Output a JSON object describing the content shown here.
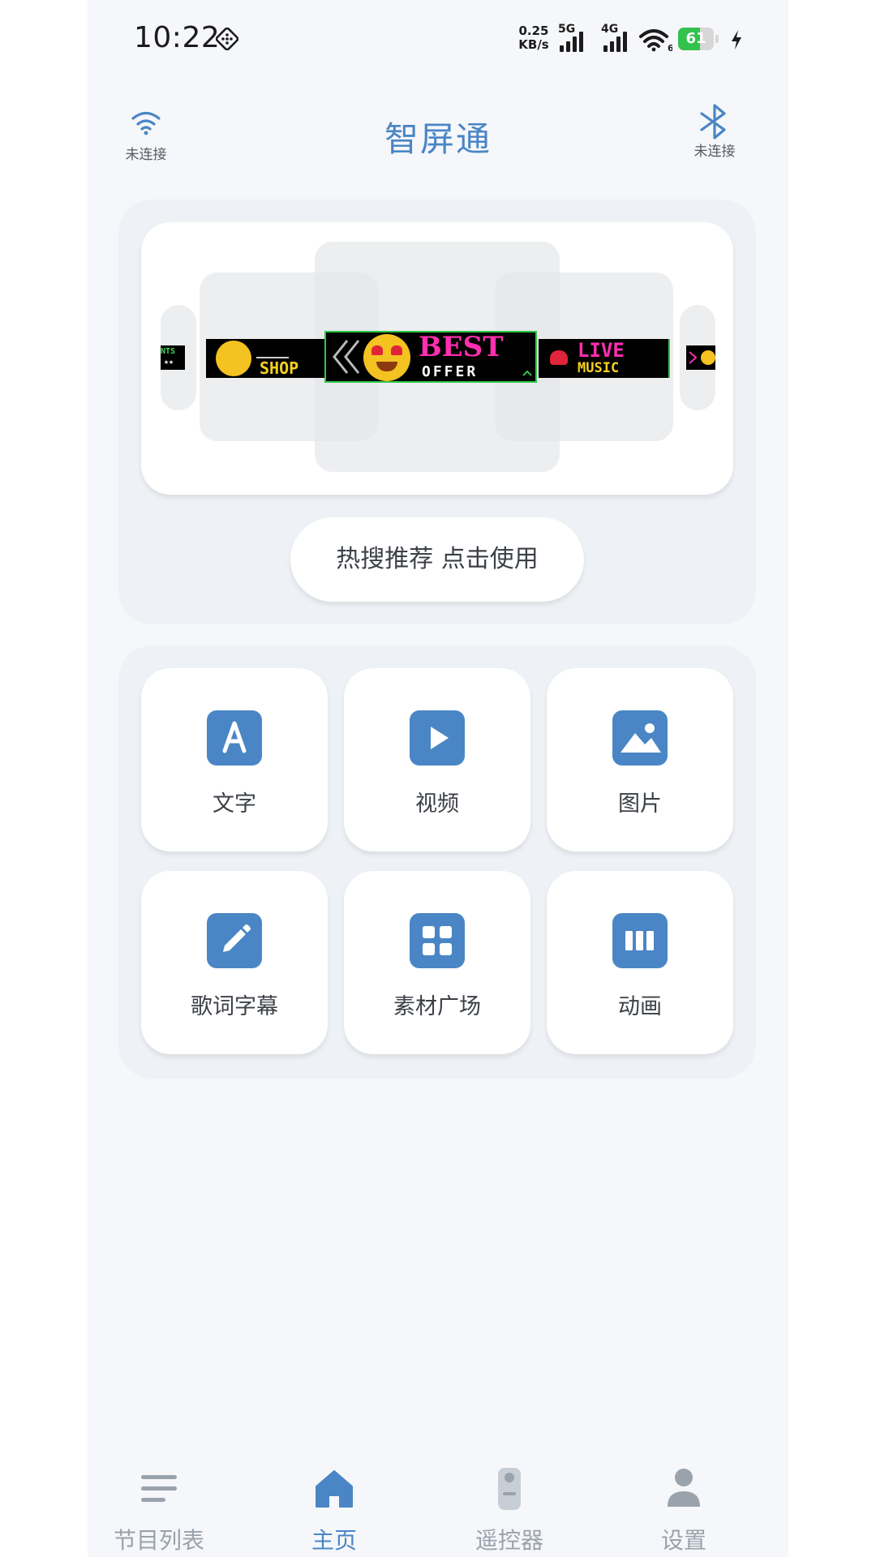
{
  "status_bar": {
    "time": "10:22",
    "speed_value": "0.25",
    "speed_unit": "KB/s",
    "net_5g": "5G",
    "net_4g": "4G",
    "wifi_badge": "6",
    "battery_level": "61",
    "icons": [
      "dice-icon",
      "signal-icon",
      "wifi-icon",
      "battery-icon",
      "charging-icon"
    ]
  },
  "header": {
    "title": "智屏通",
    "wifi": {
      "icon": "wifi-icon",
      "status": "未连接"
    },
    "bluetooth": {
      "icon": "bluetooth-icon",
      "status": "未连接"
    }
  },
  "carousel": {
    "slides": [
      {
        "text_top": "NTS",
        "text_bottom": "★★"
      },
      {
        "text": "SHOP"
      },
      {
        "title": "BEST",
        "subtitle": "OFFER"
      },
      {
        "title": "LIVE",
        "subtitle": "MUSIC"
      },
      {
        "text": ""
      }
    ],
    "active_index": 2
  },
  "hot_button": {
    "label": "热搜推荐 点击使用"
  },
  "features": [
    {
      "label": "文字",
      "icon": "text-icon"
    },
    {
      "label": "视频",
      "icon": "video-play-icon"
    },
    {
      "label": "图片",
      "icon": "image-icon"
    },
    {
      "label": "歌词字幕",
      "icon": "pencil-icon"
    },
    {
      "label": "素材广场",
      "icon": "grid-icon"
    },
    {
      "label": "动画",
      "icon": "animation-icon"
    }
  ],
  "bottom_nav": {
    "items": [
      {
        "label": "节目列表",
        "icon": "list-icon",
        "active": false
      },
      {
        "label": "主页",
        "icon": "home-icon",
        "active": true
      },
      {
        "label": "遥控器",
        "icon": "remote-icon",
        "active": false
      },
      {
        "label": "设置",
        "icon": "user-icon",
        "active": false
      }
    ]
  },
  "colors": {
    "accent": "#4a86c5",
    "inactive": "#9aa2ac",
    "card_bg": "#eef1f5",
    "page_bg": "#f5f7fa",
    "battery_green": "#33c24d"
  }
}
